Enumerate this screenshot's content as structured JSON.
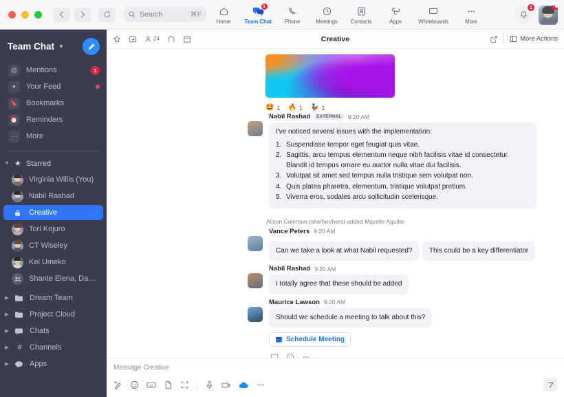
{
  "window": {
    "search": {
      "placeholder": "Search",
      "shortcut": "⌘F"
    }
  },
  "topnav": {
    "items": [
      {
        "label": "Home",
        "icon": "home-icon",
        "active": false,
        "badge": ""
      },
      {
        "label": "Team Chat",
        "icon": "team-chat-icon",
        "active": true,
        "badge": "1"
      },
      {
        "label": "Phone",
        "icon": "phone-icon",
        "active": false,
        "badge": ""
      },
      {
        "label": "Meetings",
        "icon": "meetings-icon",
        "active": false,
        "badge": ""
      },
      {
        "label": "Contacts",
        "icon": "contacts-icon",
        "active": false,
        "badge": ""
      },
      {
        "label": "Apps",
        "icon": "apps-icon",
        "active": false,
        "badge": ""
      },
      {
        "label": "Whiteboards",
        "icon": "whiteboards-icon",
        "active": false,
        "badge": ""
      },
      {
        "label": "More",
        "icon": "more-icon",
        "active": false,
        "badge": ""
      }
    ],
    "notification_badge": "1",
    "avatar_badge": ""
  },
  "sidebar": {
    "title": "Team Chat",
    "nav": [
      {
        "label": "Mentions",
        "icon": "at-icon",
        "badge": "1",
        "dot": false
      },
      {
        "label": "Your Feed",
        "icon": "feed-icon",
        "badge": "",
        "dot": true
      },
      {
        "label": "Bookmarks",
        "icon": "bookmark-icon",
        "badge": "",
        "dot": false
      },
      {
        "label": "Reminders",
        "icon": "reminder-icon",
        "badge": "",
        "dot": false
      },
      {
        "label": "More",
        "icon": "ellipsis-icon",
        "badge": "",
        "dot": false
      }
    ],
    "starred_label": "Starred",
    "chats": [
      {
        "label": "Virginia Willis (You)",
        "type": "avatar",
        "presence": "busy",
        "selected": false
      },
      {
        "label": "Nabil Rashad",
        "type": "avatar",
        "presence": "on",
        "selected": false
      },
      {
        "label": "Creative",
        "type": "channel",
        "presence": "",
        "selected": true
      },
      {
        "label": "Tori Kojuro",
        "type": "avatar",
        "presence": "busy",
        "selected": false
      },
      {
        "label": "CT Wiseley",
        "type": "avatar",
        "presence": "on",
        "selected": false
      },
      {
        "label": "Kei Umeko",
        "type": "avatar",
        "presence": "on",
        "selected": false
      },
      {
        "label": "Shante Elena, Daniel Bow...",
        "type": "group",
        "presence": "",
        "selected": false
      }
    ],
    "folders": [
      {
        "label": "Dream Team",
        "icon": "folder-icon"
      },
      {
        "label": "Project Cloud",
        "icon": "folder-icon"
      },
      {
        "label": "Chats",
        "icon": "chat-bubble-icon"
      },
      {
        "label": "Channels",
        "icon": "hash-icon"
      },
      {
        "label": "Apps",
        "icon": "apps-bubble-icon"
      }
    ]
  },
  "chat_header": {
    "title": "Creative",
    "member_count": "24",
    "more_actions_label": "More Actions"
  },
  "thread": {
    "reactions": [
      {
        "emoji": "🤩",
        "count": "1"
      },
      {
        "emoji": "🔥",
        "count": "1"
      },
      {
        "emoji": "🦆",
        "count": "1"
      }
    ],
    "messages": [
      {
        "name": "Nabil Rashad",
        "tag": "EXTERNAL",
        "time": "9:20 AM",
        "text": "I've noticed several issues with the implementation:",
        "list": [
          "Suspendisse tempor eget feugiat quis vitae.",
          "Sagittis, arcu tempus elementum neque nibh facilisis vitae id consectetur. Blandit id tempus ornare eu auctor nulla vitae dui facilisis.",
          "Volutpat sit amet sed tempus nulla tristique sem volutpat non.",
          "Quis platea pharetra, elementum, tristique volutpat pretium.",
          "Viverra eros, sodales arcu sollicitudin scelerisque."
        ]
      }
    ],
    "system_message": "Alison Coleman (she/her/hers) added Mayelle Aguilar",
    "messages2": [
      {
        "name": "Vance Peters",
        "time": "9:20 AM",
        "bubbles": [
          "Can we take a look at what Nabil requested?",
          "This could be a key differentiator"
        ]
      },
      {
        "name": "Nabil Rashad",
        "time": "9:20 AM",
        "bubbles": [
          "I totally agree that these should be added"
        ]
      },
      {
        "name": "Maurice Lawson",
        "time": "9:20 AM",
        "bubbles": [
          "Should we schedule a meeting to talk about this?"
        ]
      }
    ],
    "schedule_button": "Schedule Meeting"
  },
  "composer": {
    "placeholder": "Message Creative",
    "tools": [
      "format-icon",
      "emoji-icon",
      "gif-icon",
      "file-icon",
      "screenshot-icon",
      "mic-icon",
      "video-icon",
      "cloud-icon",
      "more-icon"
    ]
  },
  "colors": {
    "accent": "#2d74f7",
    "sidebar_bg": "#3c3c4f",
    "badge_red": "#e8233f",
    "link_blue": "#1a73e8"
  }
}
